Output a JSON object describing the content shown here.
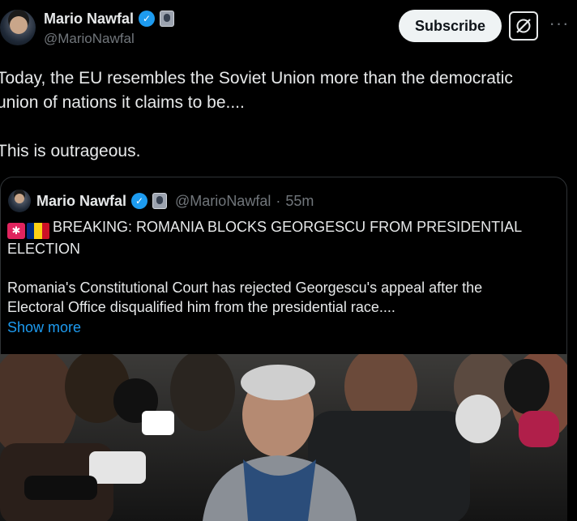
{
  "author": {
    "name": "Mario Nawfal",
    "handle": "@MarioNawfal"
  },
  "actions": {
    "subscribe_label": "Subscribe",
    "grok_icon": "grok-icon",
    "more_icon": "more-icon"
  },
  "post": {
    "text_line1": "Today, the EU resembles the Soviet Union more than the democratic",
    "text_line2": "union of nations it claims to be....",
    "text_line3": "This is outrageous."
  },
  "quote": {
    "name": "Mario Nawfal",
    "handle": "@MarioNawfal",
    "separator": "·",
    "time": "55m",
    "headline_line1": "BREAKING: ROMANIA BLOCKS GEORGESCU FROM PRESIDENTIAL",
    "headline_line2": "ELECTION",
    "body_line1": "Romania's Constitutional Court has rejected Georgescu's appeal after the",
    "body_line2": "Electoral Office disqualified him from the presidential race....",
    "show_more": "Show more"
  },
  "colors": {
    "background": "#000000",
    "text": "#e7e9ea",
    "muted": "#71767b",
    "link": "#1d9bf0",
    "verified": "#1d9bf0",
    "border": "#2f3336"
  }
}
